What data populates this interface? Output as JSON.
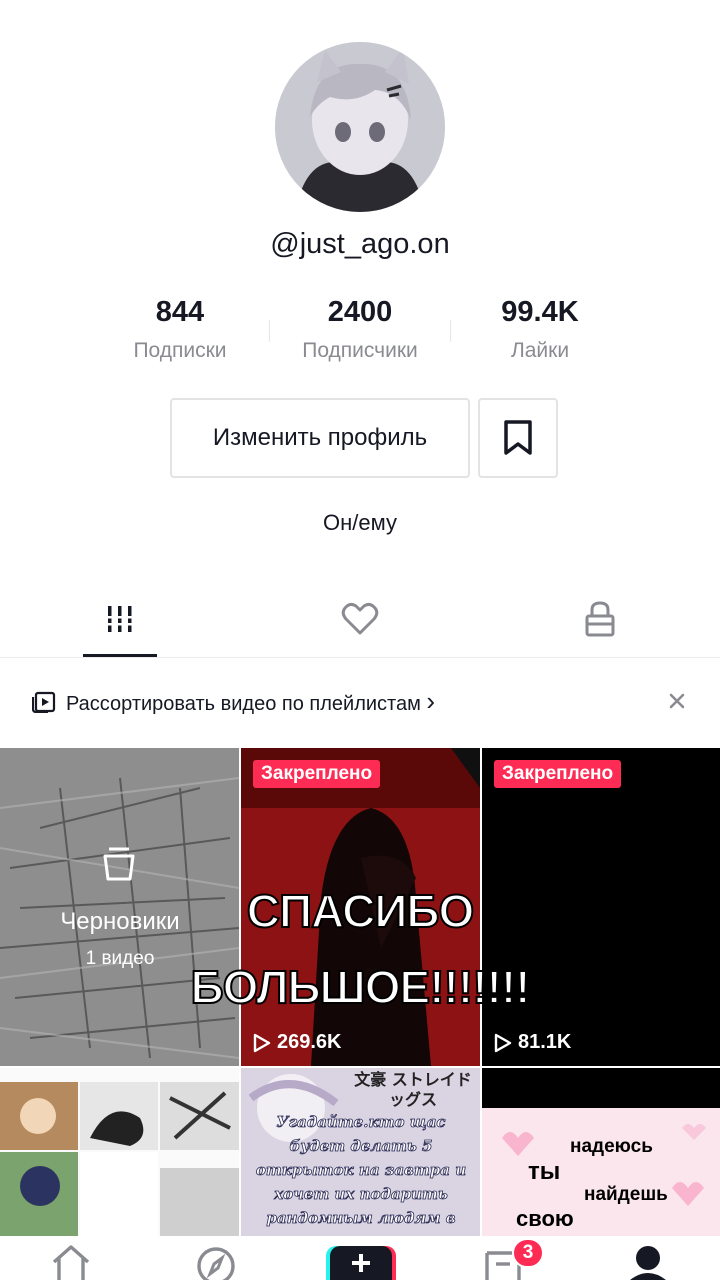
{
  "profile": {
    "username": "@just_ago.on",
    "bio": "Он/ему"
  },
  "stats": [
    {
      "value": "844",
      "label": "Подписки"
    },
    {
      "value": "2400",
      "label": "Подписчики"
    },
    {
      "value": "99.4K",
      "label": "Лайки"
    }
  ],
  "buttons": {
    "edit_profile": "Изменить профиль"
  },
  "tabs": [
    "videos-grid-icon",
    "liked-heart-icon",
    "private-lock-icon"
  ],
  "playlist_banner": {
    "text": "Рассортировать видео по плейлистам",
    "chevron": "›",
    "close": "×"
  },
  "grid": {
    "drafts": {
      "title": "Черновики",
      "count": "1 видео"
    },
    "videos": [
      {
        "pinned": "Закреплено",
        "views": "269.6K"
      },
      {
        "pinned": "Закреплено",
        "views": "81.1K"
      }
    ],
    "row2": {
      "video5_text": "Угадайте.кто щас будет делать 5 открыток на завтра и хочет их подарить рандомным людям в школе. но уже завтра",
      "video5_title": "文豪 ストレイドッグス",
      "video6_lines": [
        "надеюсь",
        "ты",
        "найдешь",
        "свою"
      ]
    }
  },
  "overlay": {
    "line1": "СПАСИБО",
    "line2": "БОЛЬШОЕ!!!!!!!"
  },
  "navbar": {
    "inbox_badge": "3"
  },
  "colors": {
    "accent": "#fe2c55",
    "text": "#161823",
    "muted": "#8a8b91"
  }
}
